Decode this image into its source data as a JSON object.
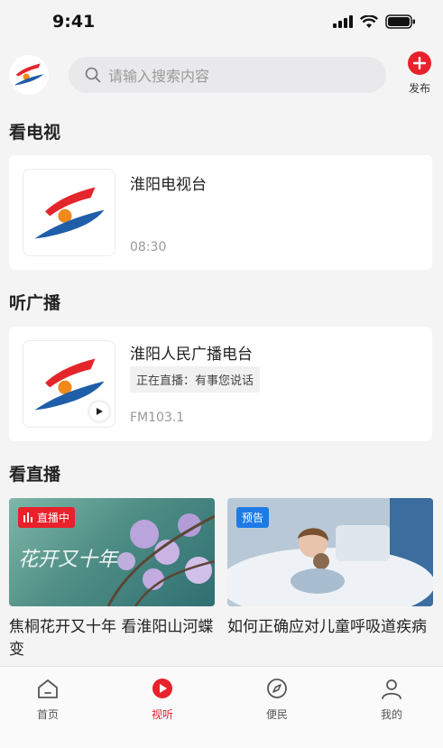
{
  "status_bar": {
    "time": "9:41"
  },
  "header": {
    "search_placeholder": "请输入搜索内容",
    "publish_label": "发布"
  },
  "sections": {
    "tv": "看电视",
    "radio": "听广播",
    "live": "看直播"
  },
  "tv_card": {
    "title": "淮阳电视台",
    "time": "08:30"
  },
  "radio_card": {
    "title": "淮阳人民广播电台",
    "live_now": "正在直播：有事您说话",
    "frequency": "FM103.1"
  },
  "live_videos": [
    {
      "badge": "直播中",
      "title": "焦桐花开又十年 看淮阳山河蝶变",
      "poster_text": "花开又十年"
    },
    {
      "badge": "预告",
      "title": "如何正确应对儿童呼吸道疾病"
    }
  ],
  "tabs": [
    {
      "label": "首页",
      "icon": "home-icon"
    },
    {
      "label": "视听",
      "icon": "play-icon",
      "active": true
    },
    {
      "label": "便民",
      "icon": "compass-icon"
    },
    {
      "label": "我的",
      "icon": "person-icon"
    }
  ],
  "colors": {
    "accent": "#e8212b",
    "preview_badge": "#1e7be6",
    "background": "#f4f4f5"
  }
}
